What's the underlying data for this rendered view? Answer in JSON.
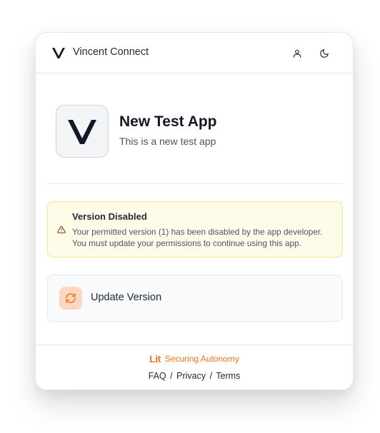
{
  "header": {
    "brand_name": "Vincent Connect",
    "icons": {
      "user": "user-icon",
      "theme": "moon-icon"
    }
  },
  "app": {
    "logo_letter": "V",
    "title": "New Test App",
    "description": "This is a new test app"
  },
  "alert": {
    "icon": "warning-triangle-icon",
    "title": "Version Disabled",
    "line1": "Your permitted version (1) has been disabled by the app developer.",
    "line2": "You must update your permissions to continue using this app."
  },
  "update": {
    "icon": "refresh-icon",
    "label": "Update Version"
  },
  "footer": {
    "logo_text": "Lit",
    "tagline": "Securing Autonomy",
    "links": [
      "FAQ",
      "Privacy",
      "Terms"
    ],
    "separator": "/"
  },
  "colors": {
    "accent": "#f97316",
    "alert_bg": "#fefce8",
    "alert_border": "#fde68a",
    "update_icon_bg": "#fed7c3"
  }
}
